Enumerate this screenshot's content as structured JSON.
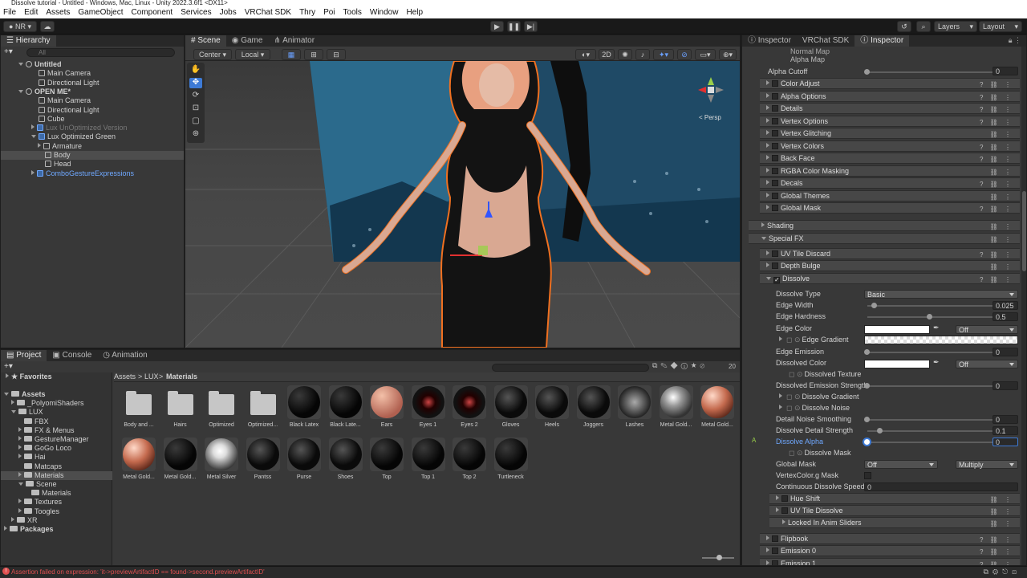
{
  "window_title": "Dissolve tutorial - Untitled - Windows, Mac, Linux - Unity 2022.3.6f1 <DX11>",
  "menu": [
    "File",
    "Edit",
    "Assets",
    "GameObject",
    "Component",
    "Services",
    "Jobs",
    "VRChat SDK",
    "Thry",
    "Poi",
    "Tools",
    "Window",
    "Help"
  ],
  "toolbar": {
    "account": "NR",
    "layers": "Layers",
    "layout": "Layout"
  },
  "hierarchy": {
    "tab": "Hierarchy",
    "search_placeholder": "All",
    "rows": [
      {
        "label": "Untitled",
        "indent": 0,
        "bold": true,
        "fold": "open",
        "icon": "unity-scene-icon"
      },
      {
        "label": "Main Camera",
        "indent": 2,
        "icon": "gameobject-icon"
      },
      {
        "label": "Directional Light",
        "indent": 2,
        "icon": "gameobject-icon"
      },
      {
        "label": "OPEN ME*",
        "indent": 0,
        "bold": true,
        "fold": "open",
        "icon": "unity-scene-icon"
      },
      {
        "label": "Main Camera",
        "indent": 2,
        "icon": "gameobject-icon"
      },
      {
        "label": "Directional Light",
        "indent": 2,
        "icon": "gameobject-icon"
      },
      {
        "label": "Cube",
        "indent": 2,
        "icon": "gameobject-icon"
      },
      {
        "label": "Lux UnOptimized Version",
        "indent": 2,
        "fold": "closed",
        "dim": true,
        "icon": "prefab-icon"
      },
      {
        "label": "Lux Optimized Green",
        "indent": 2,
        "fold": "open",
        "icon": "prefab-icon"
      },
      {
        "label": "Armature",
        "indent": 3,
        "fold": "closed",
        "icon": "gameobject-icon"
      },
      {
        "label": "Body",
        "indent": 3,
        "selected": true,
        "icon": "gameobject-icon"
      },
      {
        "label": "Head",
        "indent": 3,
        "icon": "gameobject-icon"
      },
      {
        "label": "ComboGestureExpressions",
        "indent": 2,
        "fold": "closed",
        "blue": true,
        "icon": "prefab-icon"
      }
    ]
  },
  "scene": {
    "tabs": [
      "Scene",
      "Game",
      "Animator"
    ],
    "pivot": "Center",
    "space": "Local",
    "mode_2d": "2D",
    "persp_label": "< Persp"
  },
  "project": {
    "tabs": [
      "Project",
      "Console",
      "Animation"
    ],
    "breadcrumb": [
      "Assets",
      "LUX",
      "Materials"
    ],
    "favorites": "Favorites",
    "tree": [
      {
        "label": "Assets",
        "indent": 0,
        "bold": true,
        "fold": "open"
      },
      {
        "label": "_PolyomiShaders",
        "indent": 1,
        "fold": "closed"
      },
      {
        "label": "LUX",
        "indent": 1,
        "fold": "open"
      },
      {
        "label": "FBX",
        "indent": 2
      },
      {
        "label": "FX & Menus",
        "indent": 2,
        "fold": "closed"
      },
      {
        "label": "GestureManager",
        "indent": 2,
        "fold": "closed"
      },
      {
        "label": "GoGo Loco",
        "indent": 2,
        "fold": "closed"
      },
      {
        "label": "Hai",
        "indent": 2,
        "fold": "closed"
      },
      {
        "label": "Matcaps",
        "indent": 2
      },
      {
        "label": "Materials",
        "indent": 2,
        "selected": true,
        "fold": "closed"
      },
      {
        "label": "Scene",
        "indent": 2,
        "fold": "open"
      },
      {
        "label": "Materials",
        "indent": 3
      },
      {
        "label": "Textures",
        "indent": 2,
        "fold": "closed"
      },
      {
        "label": "Toogles",
        "indent": 2,
        "fold": "closed"
      },
      {
        "label": "XR",
        "indent": 1,
        "fold": "closed"
      },
      {
        "label": "Packages",
        "indent": 0,
        "bold": true,
        "fold": "closed"
      }
    ],
    "assets_row1": [
      {
        "label": "Body and ...",
        "kind": "folder"
      },
      {
        "label": "Hairs",
        "kind": "folder"
      },
      {
        "label": "Optimized",
        "kind": "folder"
      },
      {
        "label": "Optimized...",
        "kind": "folder"
      },
      {
        "label": "Black Latex",
        "kind": "black"
      },
      {
        "label": "Black Late...",
        "kind": "black"
      },
      {
        "label": "Ears",
        "kind": "skin"
      },
      {
        "label": "Eyes 1",
        "kind": "eye"
      },
      {
        "label": "Eyes 2",
        "kind": "eye"
      },
      {
        "label": "Gloves",
        "kind": "dark"
      },
      {
        "label": "Heels",
        "kind": "dark"
      },
      {
        "label": "Joggers",
        "kind": "dark"
      },
      {
        "label": "Lashes",
        "kind": "lash"
      },
      {
        "label": "Metal Gold...",
        "kind": "chrome"
      },
      {
        "label": "Metal Gold...",
        "kind": "copper"
      }
    ],
    "assets_row2": [
      {
        "label": "Metal Gold...",
        "kind": "copper"
      },
      {
        "label": "Metal Gold...",
        "kind": "black"
      },
      {
        "label": "Metal Silver",
        "kind": "silver"
      },
      {
        "label": "Pantss",
        "kind": "dark"
      },
      {
        "label": "Purse",
        "kind": "dark"
      },
      {
        "label": "Shoes",
        "kind": "dark"
      },
      {
        "label": "Top",
        "kind": "black"
      },
      {
        "label": "Top 1",
        "kind": "black"
      },
      {
        "label": "Top 2",
        "kind": "black"
      },
      {
        "label": "Turtleneck",
        "kind": "black"
      }
    ],
    "count": "20"
  },
  "inspector": {
    "tabs": [
      "Inspector",
      "VRChat SDK",
      "Inspector"
    ],
    "top_rows": [
      "Normal Map",
      "Alpha Map"
    ],
    "alpha_cutoff": {
      "label": "Alpha Cutoff",
      "value": "0"
    },
    "sections_a": [
      "Color Adjust",
      "Alpha Options",
      "Details",
      "Vertex Options",
      "Vertex Glitching",
      "Vertex Colors",
      "Back Face",
      "RGBA Color Masking",
      "Decals",
      "Global Themes",
      "Global Mask"
    ],
    "shading": "Shading",
    "special_fx": "Special FX",
    "fx_sections": [
      "UV Tile Discard",
      "Depth Bulge"
    ],
    "dissolve": "Dissolve",
    "dissolve_type": {
      "label": "Dissolve Type",
      "value": "Basic"
    },
    "edge_width": {
      "label": "Edge Width",
      "value": "0.025",
      "fraction": 0.06
    },
    "edge_hardness": {
      "label": "Edge Hardness",
      "value": "0.5",
      "fraction": 0.5
    },
    "edge_color": {
      "label": "Edge Color",
      "mode": "Off"
    },
    "edge_gradient": "Edge Gradient",
    "edge_emission": {
      "label": "Edge Emission",
      "value": "0",
      "fraction": 0
    },
    "dissolved_color": {
      "label": "Dissolved Color",
      "mode": "Off"
    },
    "dissolved_texture": "Dissolved Texture",
    "dissolved_emission": {
      "label": "Dissolved Emission Strength",
      "value": "0",
      "fraction": 0
    },
    "dissolve_gradient": "Dissolve Gradient",
    "dissolve_noise": "Dissolve Noise",
    "detail_noise_smoothing": {
      "label": "Detail Noise Smoothing",
      "value": "0",
      "fraction": 0
    },
    "dissolve_detail_strength": {
      "label": "Dissolve Detail Strength",
      "value": "0.1",
      "fraction": 0.1
    },
    "dissolve_alpha": {
      "label": "Dissolve Alpha",
      "value": "0",
      "fraction": 0,
      "marker": "A"
    },
    "dissolve_mask": "Dissolve Mask",
    "global_mask": {
      "label": "Global Mask",
      "value": "Off",
      "blend": "Multiply"
    },
    "vertexcolor_mask": "VertexColor.g Mask",
    "continuous_speed": {
      "label": "Continuous Dissolve Speed",
      "value": "0"
    },
    "sub_sections": [
      "Hue Shift",
      "UV Tile Dissolve",
      "Locked In Anim Sliders"
    ],
    "sections_b": [
      "Flipbook",
      "Emission 0",
      "Emission 1"
    ]
  },
  "status": {
    "message": "Assertion failed on expression: 'it->previewArtifactID == found->second.previewArtifactID'"
  },
  "colors": {
    "accent": "#3d7ad6",
    "outline": "#f07020",
    "error": "#e05050"
  }
}
